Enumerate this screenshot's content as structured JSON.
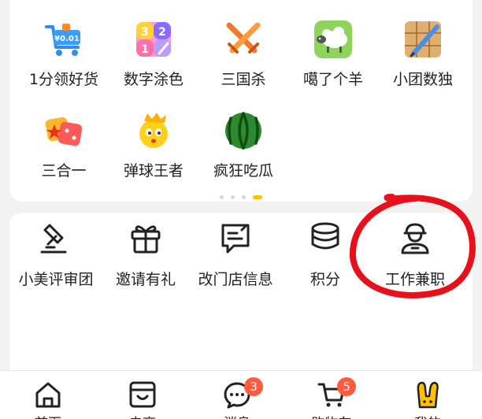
{
  "games": {
    "items": [
      {
        "label": "1分领好货",
        "icon": "cart-coin-icon",
        "price_tag": "¥0.01"
      },
      {
        "label": "数字涂色",
        "icon": "number-color-icon",
        "digits": [
          "3",
          "2",
          "1"
        ]
      },
      {
        "label": "三国杀",
        "icon": "crossed-swords-icon"
      },
      {
        "label": "噶了个羊",
        "icon": "sheep-icon"
      },
      {
        "label": "小团数独",
        "icon": "sudoku-pencil-icon"
      },
      {
        "label": "三合一",
        "icon": "dice-icon"
      },
      {
        "label": "弹球王者",
        "icon": "crowned-ball-icon"
      },
      {
        "label": "疯狂吃瓜",
        "icon": "watermelon-icon"
      }
    ],
    "pager": {
      "count": 4,
      "active": 3
    }
  },
  "tools": {
    "items": [
      {
        "label": "小美评审团",
        "icon": "gavel-icon"
      },
      {
        "label": "邀请有礼",
        "icon": "gift-icon"
      },
      {
        "label": "改门店信息",
        "icon": "edit-message-icon"
      },
      {
        "label": "积分",
        "icon": "coin-stack-icon"
      },
      {
        "label": "工作兼职",
        "icon": "worker-icon"
      }
    ]
  },
  "annotation": {
    "color": "#e8101b",
    "target": "工作兼职"
  },
  "tabbar": {
    "items": [
      {
        "label": "首页",
        "icon": "home-icon"
      },
      {
        "label": "电商",
        "icon": "shop-box-icon"
      },
      {
        "label": "消息",
        "icon": "chat-bubble-icon",
        "badge": "3"
      },
      {
        "label": "购物车",
        "icon": "shopping-cart-icon",
        "badge": "5"
      },
      {
        "label": "我的",
        "icon": "rabbit-mascot-icon"
      }
    ]
  },
  "colors": {
    "accent": "#ffc000",
    "badge": "#ff5a3c",
    "text": "#222222"
  }
}
